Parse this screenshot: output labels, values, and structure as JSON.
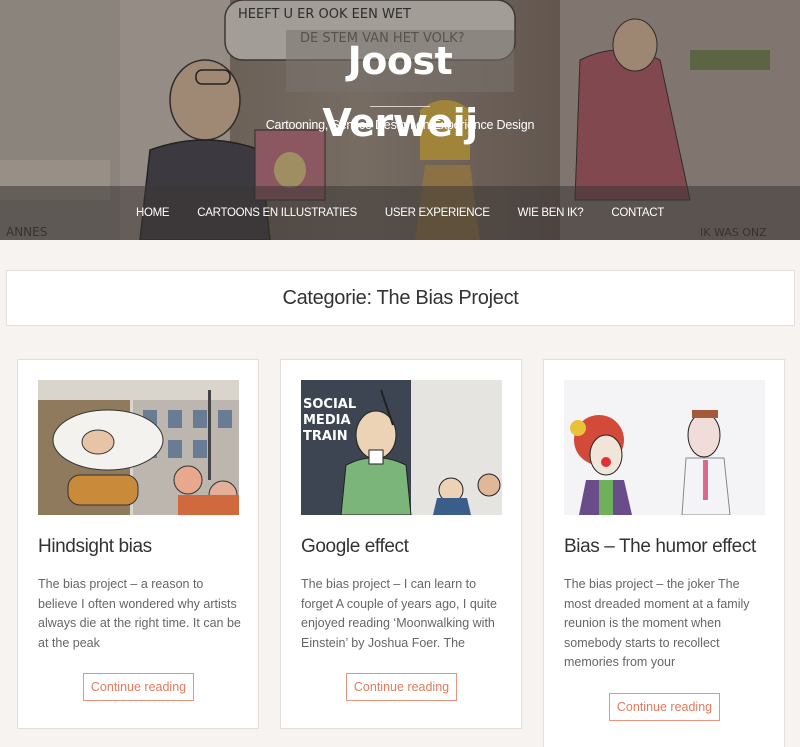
{
  "site": {
    "title": "Joost Verweij",
    "tagline": "Cartooning, Service Design en Experience Design"
  },
  "nav": {
    "items": [
      {
        "label": "HOME"
      },
      {
        "label": "CARTOONS EN ILLUSTRATIES"
      },
      {
        "label": "USER EXPERIENCE"
      },
      {
        "label": "WIE BEN IK?"
      },
      {
        "label": "CONTACT"
      }
    ]
  },
  "header_art": {
    "speech_text": "HEEFT U ER OOK EEN WET DE STEM VAN HET VOLK?",
    "sign_left": "ANNES",
    "sign_right": "IK WAS ONZ"
  },
  "category": {
    "title": "Categorie: The Bias Project"
  },
  "posts": [
    {
      "title": "Hindsight bias",
      "excerpt": "The bias project – a reason to believe I often wondered why artists always die at the right time. It can be at the peak",
      "button": "Continue reading"
    },
    {
      "title": "Google effect",
      "excerpt": "The bias project – I can learn to forget A couple of years ago, I quite enjoyed reading ‘Moonwalking with Einstein’ by Joshua Foer. The",
      "button": "Continue reading",
      "image_text": "SOCIAL MEDIA TRAIN"
    },
    {
      "title": "Bias – The humor effect",
      "excerpt": "The bias project – the joker The most dreaded moment at a family reunion is the moment when somebody starts to recollect memories from your",
      "button": "Continue reading"
    }
  ],
  "colors": {
    "accent": "#e27b5d",
    "background": "#f7f3f1"
  }
}
